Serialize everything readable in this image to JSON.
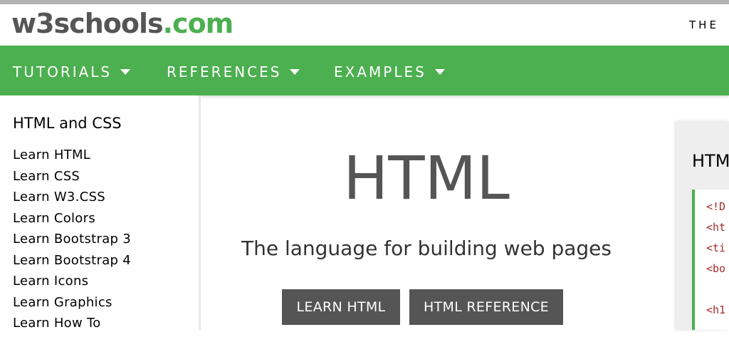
{
  "header": {
    "logo_part1": "w3schools",
    "logo_part2": ".com",
    "right_text": "THE"
  },
  "nav": {
    "items": [
      {
        "label": "TUTORIALS"
      },
      {
        "label": "REFERENCES"
      },
      {
        "label": "EXAMPLES"
      }
    ]
  },
  "sidebar": {
    "heading": "HTML and CSS",
    "items": [
      {
        "label": "Learn HTML"
      },
      {
        "label": "Learn CSS"
      },
      {
        "label": "Learn W3.CSS"
      },
      {
        "label": "Learn Colors"
      },
      {
        "label": "Learn Bootstrap 3"
      },
      {
        "label": "Learn Bootstrap 4"
      },
      {
        "label": "Learn Icons"
      },
      {
        "label": "Learn Graphics"
      },
      {
        "label": "Learn How To"
      }
    ]
  },
  "hero": {
    "title": "HTML",
    "subtitle": "The language for building web pages",
    "buttons": [
      {
        "label": "LEARN HTML"
      },
      {
        "label": "HTML REFERENCE"
      }
    ]
  },
  "example": {
    "title": "HTM",
    "code_lines": [
      "<!D",
      "<ht",
      "<ti",
      "<bo",
      "",
      "<h1"
    ]
  },
  "colors": {
    "brand_green": "#4CAF50",
    "dark_gray": "#555555",
    "code_tag": "#a52a2a"
  }
}
